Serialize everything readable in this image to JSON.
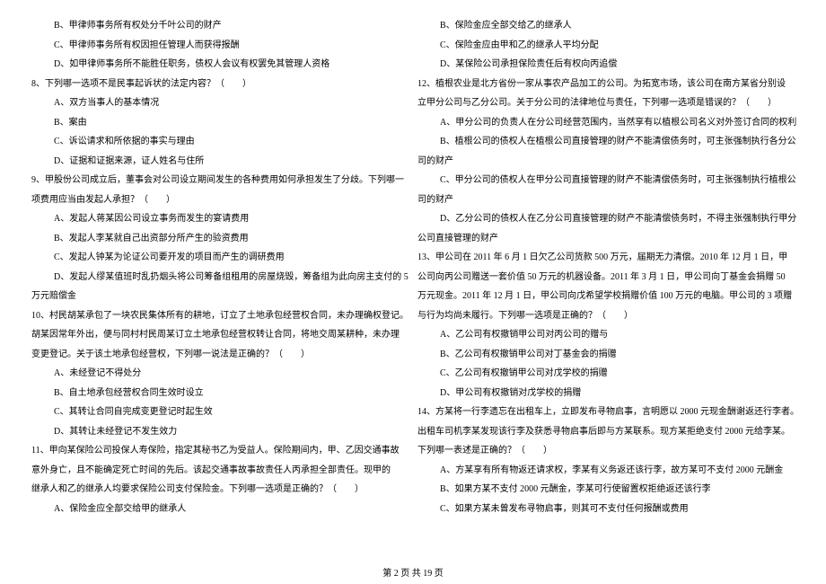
{
  "left": [
    {
      "cls": "opt",
      "t": "B、甲律师事务所有权处分千叶公司的财产"
    },
    {
      "cls": "opt",
      "t": "C、甲律师事务所有权因担任管理人而获得报酬"
    },
    {
      "cls": "opt",
      "t": "D、如甲律师事务所不能胜任职务，债权人会议有权罢免其管理人资格"
    },
    {
      "cls": "q",
      "t": "8、下列哪一选项不是民事起诉状的法定内容？（　　）"
    },
    {
      "cls": "opt",
      "t": "A、双方当事人的基本情况"
    },
    {
      "cls": "opt",
      "t": "B、案由"
    },
    {
      "cls": "opt",
      "t": "C、诉讼请求和所依据的事实与理由"
    },
    {
      "cls": "opt",
      "t": "D、证据和证据来源，证人姓名与住所"
    },
    {
      "cls": "q",
      "t": "9、甲股份公司成立后，董事会对公司设立期间发生的各种费用如何承担发生了分歧。下列哪一"
    },
    {
      "cls": "par2",
      "t": "项费用应当由发起人承担？（　　）"
    },
    {
      "cls": "opt",
      "t": "A、发起人蒋某因公司设立事务而发生的宴请费用"
    },
    {
      "cls": "opt",
      "t": "B、发起人李某就自己出资部分所产生的验资费用"
    },
    {
      "cls": "opt",
      "t": "C、发起人钟某为论证公司要开发的项目而产生的调研费用"
    },
    {
      "cls": "opt",
      "t": "D、发起人缪某值班时乱扔烟头将公司筹备组租用的房屋烧毁，筹备组为此向房主支付的 5"
    },
    {
      "cls": "q",
      "t": "万元赔偿金"
    },
    {
      "cls": "q",
      "t": "10、村民胡某承包了一块农民集体所有的耕地，订立了土地承包经营权合同，未办理确权登记。"
    },
    {
      "cls": "par2",
      "t": "胡某因常年外出，便与同村村民周某订立土地承包经营权转让合同，将地交周某耕种，未办理"
    },
    {
      "cls": "par2",
      "t": "变更登记。关于该土地承包经营权，下列哪一说法是正确的？（　　）"
    },
    {
      "cls": "opt",
      "t": "A、未经登记不得处分"
    },
    {
      "cls": "opt",
      "t": "B、自土地承包经营权合同生效时设立"
    },
    {
      "cls": "opt",
      "t": "C、其转让合同自完成变更登记时起生效"
    },
    {
      "cls": "opt",
      "t": "D、其转让未经登记不发生效力"
    },
    {
      "cls": "q",
      "t": "11、甲向某保险公司投保人寿保险，指定其秘书乙为受益人。保险期间内，甲、乙因交通事故"
    },
    {
      "cls": "par2",
      "t": "意外身亡，且不能确定死亡时间的先后。该起交通事故事故责任人丙承担全部责任。现甲的"
    },
    {
      "cls": "par2",
      "t": "继承人和乙的继承人均要求保险公司支付保险金。下列哪一选项是正确的？（　　）"
    },
    {
      "cls": "opt",
      "t": "A、保险金应全部交给甲的继承人"
    }
  ],
  "right": [
    {
      "cls": "opt",
      "t": "B、保险金应全部交给乙的继承人"
    },
    {
      "cls": "opt",
      "t": "C、保险金应由甲和乙的继承人平均分配"
    },
    {
      "cls": "opt",
      "t": "D、某保险公司承担保险责任后有权向丙追偿"
    },
    {
      "cls": "q",
      "t": "12、植根农业是北方省份一家从事农产品加工的公司。为拓宽市场，该公司在南方某省分别设"
    },
    {
      "cls": "par2",
      "t": "立甲分公司与乙分公司。关于分公司的法律地位与责任，下列哪一选项是错误的？（　　）"
    },
    {
      "cls": "opt",
      "t": "A、甲分公司的负责人在分公司经营范围内，当然享有以植根公司名义对外签订合同的权利"
    },
    {
      "cls": "opt",
      "t": "B、植根公司的债权人在植根公司直接管理的财产不能清偿债务时，可主张强制执行各分公"
    },
    {
      "cls": "par2",
      "t": "司的财产"
    },
    {
      "cls": "opt",
      "t": "C、甲分公司的债权人在甲分公司直接管理的财产不能清偿债务时，可主张强制执行植根公"
    },
    {
      "cls": "par2",
      "t": "司的财产"
    },
    {
      "cls": "opt",
      "t": "D、乙分公司的债权人在乙分公司直接管理的财产不能清偿债务时，不得主张强制执行甲分"
    },
    {
      "cls": "par2",
      "t": "公司直接管理的财产"
    },
    {
      "cls": "q",
      "t": "13、甲公司在 2011 年 6 月 1 日欠乙公司货款 500 万元，届期无力清偿。2010 年 12 月 1 日，甲"
    },
    {
      "cls": "par2",
      "t": "公司向丙公司赠送一套价值 50 万元的机器设备。2011 年 3 月 1 日，甲公司向丁基金会捐赠 50"
    },
    {
      "cls": "par2",
      "t": "万元现金。2011 年 12 月 1 日，甲公司向戊希望学校捐赠价值 100 万元的电脑。甲公司的 3 项赠"
    },
    {
      "cls": "par2",
      "t": "与行为均尚未履行。下列哪一选项是正确的？（　　）"
    },
    {
      "cls": "opt",
      "t": "A、乙公司有权撤销甲公司对丙公司的赠与"
    },
    {
      "cls": "opt",
      "t": "B、乙公司有权撤销甲公司对丁基金会的捐赠"
    },
    {
      "cls": "opt",
      "t": "C、乙公司有权撤销甲公司对戊学校的捐赠"
    },
    {
      "cls": "opt",
      "t": "D、甲公司有权撤销对戊学校的捐赠"
    },
    {
      "cls": "q",
      "t": "14、方某将一行李遗忘在出租车上，立即发布寻物启事，言明愿以 2000 元现金酬谢返还行李者。"
    },
    {
      "cls": "par2",
      "t": "出租车司机李某发现该行李及获悉寻物启事后即与方某联系。现方某拒绝支付 2000 元给李某。"
    },
    {
      "cls": "par2",
      "t": "下列哪一表述是正确的？（　　）"
    },
    {
      "cls": "opt",
      "t": "A、方某享有所有物返还请求权，李某有义务返还该行李，故方某可不支付 2000 元酬金"
    },
    {
      "cls": "opt",
      "t": "B、如果方某不支付 2000 元酬金，李某可行使留置权拒绝返还该行李"
    },
    {
      "cls": "opt",
      "t": "C、如果方某未曾发布寻物启事，则其可不支付任何报酬或费用"
    }
  ],
  "footer": "第 2 页 共 19 页"
}
